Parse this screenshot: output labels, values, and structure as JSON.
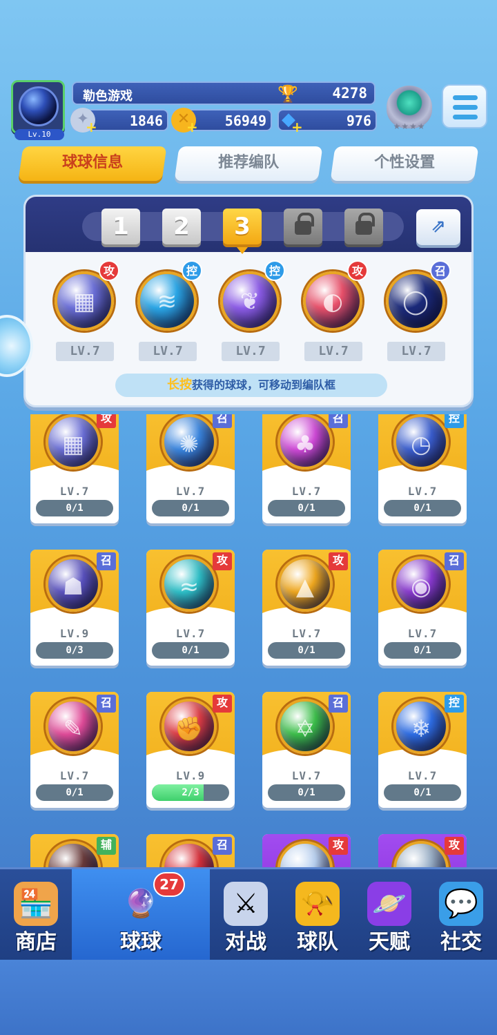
{
  "player": {
    "name": "勒色游戏",
    "level": "Lv.10",
    "trophies": "4278",
    "resources": [
      {
        "icon": "silver-coin-icon",
        "value": "1846",
        "color": "#c4d0e6"
      },
      {
        "icon": "gold-coin-icon",
        "value": "56949",
        "color": "#f7b51e"
      },
      {
        "icon": "diamond-icon",
        "value": "976",
        "color": "#48a8ff"
      }
    ]
  },
  "tabs": [
    {
      "label": "球球信息",
      "active": true
    },
    {
      "label": "推荐编队",
      "active": false
    },
    {
      "label": "个性设置",
      "active": false
    }
  ],
  "team": {
    "slots": [
      {
        "label": "1",
        "state": "normal"
      },
      {
        "label": "2",
        "state": "normal"
      },
      {
        "label": "3",
        "state": "active"
      },
      {
        "label": "",
        "state": "locked"
      },
      {
        "label": "",
        "state": "locked"
      }
    ],
    "balls": [
      {
        "type": "攻",
        "lv": "LV.7",
        "color": "#6b6fd8",
        "glyph": "▦",
        "typeClass": "t-gong"
      },
      {
        "type": "控",
        "lv": "LV.7",
        "color": "#2aa6e6",
        "glyph": "≋",
        "typeClass": "t-kong"
      },
      {
        "type": "控",
        "lv": "LV.7",
        "color": "#8c5ce6",
        "glyph": "❦",
        "typeClass": "t-kong"
      },
      {
        "type": "攻",
        "lv": "LV.7",
        "color": "#e8506a",
        "glyph": "◐",
        "typeClass": "t-gong"
      },
      {
        "type": "召",
        "lv": "LV.7",
        "color": "#1b2a7a",
        "glyph": "◯",
        "typeClass": "t-zhao"
      }
    ],
    "hint_key": "长按",
    "hint_text": "获得的球球，可移动到编队框"
  },
  "collection": [
    {
      "type": "攻",
      "lv": "LV.7",
      "progress": "0/1",
      "fill": 0,
      "color": "#6b6fd8",
      "glyph": "▦",
      "typeClass": "t-gong",
      "bg": "yellow"
    },
    {
      "type": "召",
      "lv": "LV.7",
      "progress": "0/1",
      "fill": 0,
      "color": "#3a86e0",
      "glyph": "✺",
      "typeClass": "t-zhao",
      "bg": "yellow"
    },
    {
      "type": "召",
      "lv": "LV.7",
      "progress": "0/1",
      "fill": 0,
      "color": "#d04ad8",
      "glyph": "♣",
      "typeClass": "t-zhao",
      "bg": "yellow"
    },
    {
      "type": "控",
      "lv": "LV.7",
      "progress": "0/1",
      "fill": 0,
      "color": "#3a5ed0",
      "glyph": "◷",
      "typeClass": "t-kong",
      "bg": "yellow"
    },
    {
      "type": "召",
      "lv": "LV.9",
      "progress": "0/3",
      "fill": 0,
      "color": "#5a52c0",
      "glyph": "☗",
      "typeClass": "t-zhao",
      "bg": "yellow"
    },
    {
      "type": "攻",
      "lv": "LV.7",
      "progress": "0/1",
      "fill": 0,
      "color": "#2ec0c8",
      "glyph": "≈",
      "typeClass": "t-gong",
      "bg": "yellow"
    },
    {
      "type": "攻",
      "lv": "LV.7",
      "progress": "0/1",
      "fill": 0,
      "color": "#f0a81e",
      "glyph": "▲",
      "typeClass": "t-gong",
      "bg": "yellow"
    },
    {
      "type": "召",
      "lv": "LV.7",
      "progress": "0/1",
      "fill": 0,
      "color": "#8a3ad0",
      "glyph": "◉",
      "typeClass": "t-zhao",
      "bg": "yellow"
    },
    {
      "type": "召",
      "lv": "LV.7",
      "progress": "0/1",
      "fill": 0,
      "color": "#e24c9a",
      "glyph": "✎",
      "typeClass": "t-zhao",
      "bg": "yellow"
    },
    {
      "type": "攻",
      "lv": "LV.9",
      "progress": "2/3",
      "fill": 0.667,
      "color": "#e03c44",
      "glyph": "✊",
      "typeClass": "t-gong",
      "bg": "yellow"
    },
    {
      "type": "召",
      "lv": "LV.7",
      "progress": "0/1",
      "fill": 0,
      "color": "#3cc04a",
      "glyph": "✡",
      "typeClass": "t-zhao",
      "bg": "yellow"
    },
    {
      "type": "控",
      "lv": "LV.7",
      "progress": "0/1",
      "fill": 0,
      "color": "#2e6ee6",
      "glyph": "❄",
      "typeClass": "t-kong",
      "bg": "yellow"
    },
    {
      "type": "辅",
      "lv": "",
      "progress": "",
      "fill": 0,
      "color": "#6a3a3a",
      "glyph": "",
      "typeClass": "t-fu",
      "bg": "yellow"
    },
    {
      "type": "召",
      "lv": "",
      "progress": "",
      "fill": 0,
      "color": "#d8303a",
      "glyph": "",
      "typeClass": "t-zhao",
      "bg": "yellow"
    },
    {
      "type": "攻",
      "lv": "",
      "progress": "",
      "fill": 0,
      "color": "#b8d0f0",
      "glyph": "",
      "typeClass": "t-gong",
      "bg": "purple"
    },
    {
      "type": "攻",
      "lv": "",
      "progress": "",
      "fill": 0,
      "color": "#9ab0c8",
      "glyph": "",
      "typeClass": "t-gong",
      "bg": "purple"
    }
  ],
  "nav": [
    {
      "label": "商店",
      "icon": "shop-icon",
      "glyph": "🏪",
      "active": false
    },
    {
      "label": "球球",
      "icon": "balls-icon",
      "glyph": "🔮",
      "active": true,
      "badge": "27"
    },
    {
      "label": "对战",
      "icon": "swords-icon",
      "glyph": "⚔",
      "active": false
    },
    {
      "label": "球队",
      "icon": "whistle-icon",
      "glyph": "📯",
      "active": false
    },
    {
      "label": "天赋",
      "icon": "planet-icon",
      "glyph": "🪐",
      "active": false
    },
    {
      "label": "社交",
      "icon": "chat-heart-icon",
      "glyph": "💬",
      "active": false
    }
  ]
}
